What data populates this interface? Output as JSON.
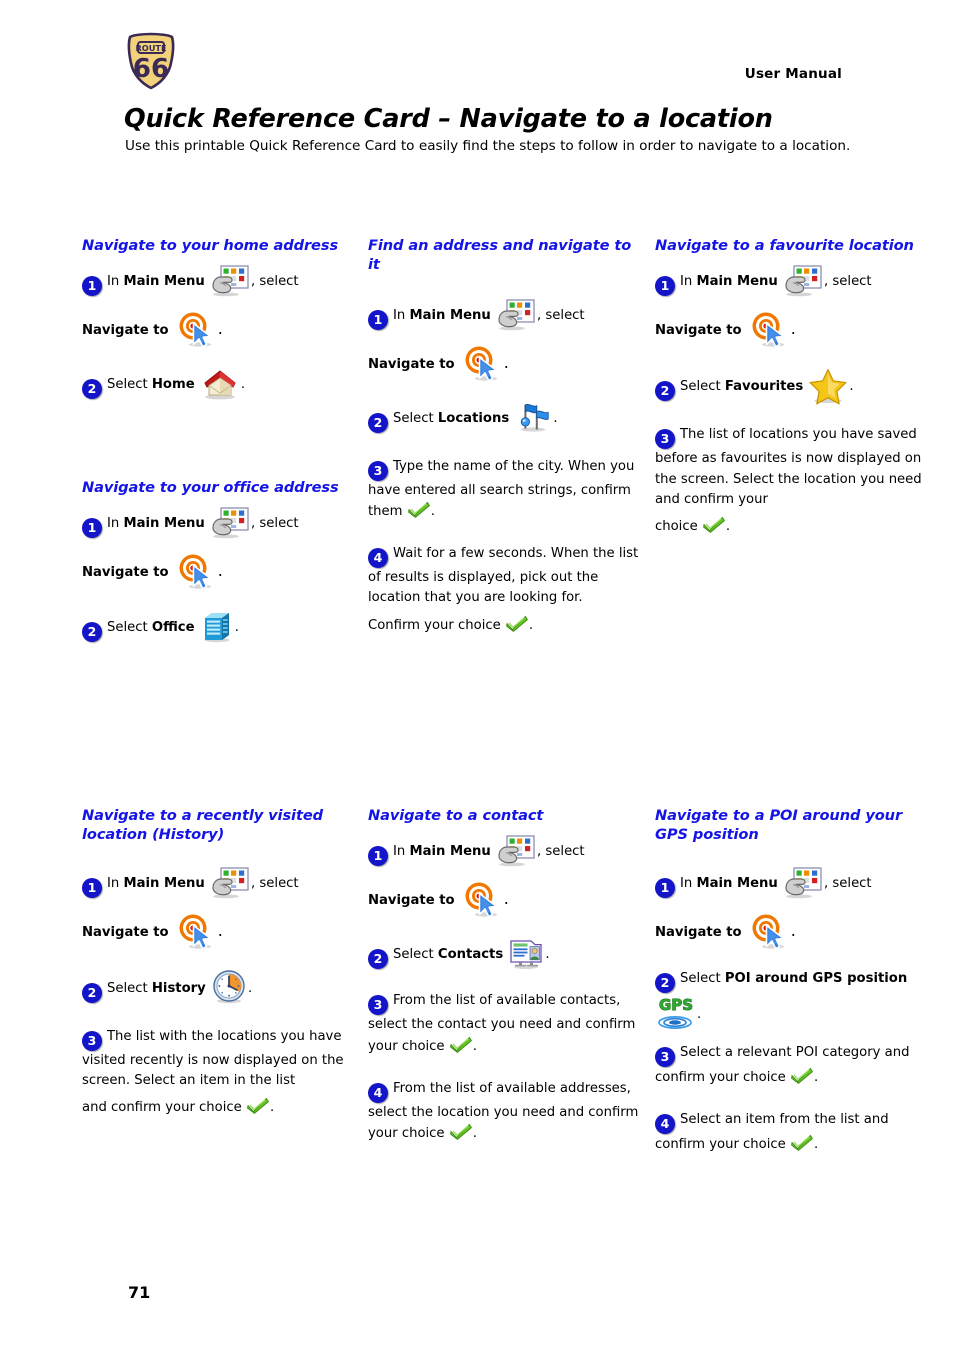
{
  "header": {
    "logo_alt": "ROUTE 66",
    "logo_top_text": "ROUTE",
    "logo_number": "66",
    "manual_label": "User Manual",
    "title": "Quick Reference Card – Navigate to a location",
    "subtitle": "Use this printable Quick Reference Card to easily find the steps to follow in order to navigate to a location."
  },
  "common": {
    "in_label": "In",
    "main_menu_label": "Main Menu",
    "select_suffix": ", select",
    "navigate_to_label": "Navigate to",
    "period": ".",
    "select_label": "Select"
  },
  "sections": {
    "home": {
      "heading": "Navigate to your home address",
      "step1_num": "1",
      "step2_num": "2",
      "step2_select": "Select",
      "step2_target": "Home"
    },
    "office": {
      "heading": "Navigate to your office address",
      "step1_num": "1",
      "step2_num": "2",
      "step2_select": "Select",
      "step2_target": "Office"
    },
    "address": {
      "heading": "Find an address and navigate to it",
      "step1_num": "1",
      "step2_num": "2",
      "step2_select": "Select",
      "step2_target": "Locations",
      "step3_num": "3",
      "step3_text_a": "Type the name of the city. When you have entered all search strings, confirm them",
      "step4_num": "4",
      "step4_text_a": "Wait for a few seconds. When the list of results is displayed, pick out the location that you are looking for.",
      "step4_text_b": "Confirm your choice"
    },
    "favourite": {
      "heading": "Navigate to a favourite location",
      "step1_num": "1",
      "step2_num": "2",
      "step2_select": "Select",
      "step2_target": "Favourites",
      "step3_num": "3",
      "step3_text_a": "The list of locations you have saved before as favourites is now displayed on the screen. Select the location you need and confirm your",
      "step3_text_b": "choice"
    },
    "history": {
      "heading": "Navigate to a recently visited location (History)",
      "step1_num": "1",
      "step2_num": "2",
      "step2_select": "Select",
      "step2_target": "History",
      "step3_num": "3",
      "step3_text_a": "The list with the locations you have visited recently is now displayed on the screen. Select an item in the list",
      "step3_text_b": "and confirm your choice"
    },
    "contact": {
      "heading": "Navigate to a contact",
      "step1_num": "1",
      "step2_num": "2",
      "step2_select": "Select",
      "step2_target": "Contacts",
      "step3_num": "3",
      "step3_text_a": "From the list of available contacts, select the contact you need and confirm your choice",
      "step4_num": "4",
      "step4_text_a": "From the list of available addresses, select the location you need and confirm your choice"
    },
    "poi": {
      "heading": "Navigate to a POI around your GPS position",
      "step1_num": "1",
      "step2_num": "2",
      "step2_select": "Select",
      "step2_target": "POI around GPS position",
      "step3_num": "3",
      "step3_text_a": "Select a relevant POI category and confirm your choice",
      "step4_num": "4",
      "step4_text_a": "Select an item from the list and confirm your choice"
    }
  },
  "footer": {
    "page_number": "71"
  },
  "icons": {
    "main_menu": "main-menu-icon",
    "navigate_to": "navigate-to-target-icon",
    "home": "home-house-icon",
    "office": "office-building-icon",
    "locations": "locations-flags-icon",
    "favourites": "favourites-star-icon",
    "history": "history-clock-icon",
    "contacts": "contacts-card-icon",
    "gps": "gps-signal-icon",
    "confirm": "green-check-icon"
  },
  "colors": {
    "heading_blue": "#1414e6",
    "bullet_blue": "#1414c8",
    "check_green": "#63c423",
    "target_orange": "#f07800",
    "target_red": "#e01400",
    "star_yellow": "#f5c518",
    "logo_yellow": "#f2d27a",
    "logo_navy": "#3a2a55"
  }
}
